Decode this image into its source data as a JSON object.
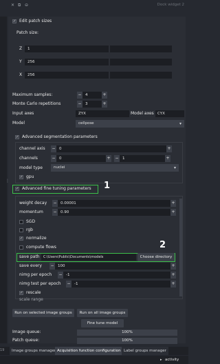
{
  "titlebar": {
    "title": "Dock widget 2"
  },
  "patch": {
    "edit_label": "Edit patch sizes",
    "size_label": "Patch size:",
    "z_label": "Z",
    "z_value": "1",
    "y_label": "Y",
    "y_value": "256",
    "x_label": "X",
    "x_value": "256"
  },
  "sampling": {
    "max_label": "Maximum samples:",
    "max_value": "4",
    "mc_label": "Monte Carlo repetitions",
    "mc_value": "3"
  },
  "axes": {
    "input_label": "Input axes",
    "input_value": "ZYX",
    "model_label": "Model axes",
    "model_value": "CYX"
  },
  "model": {
    "label": "Model",
    "value": "cellpose"
  },
  "seg": {
    "adv_label": "Advanced segmentation parameters",
    "channel_axis_label": "channel axis",
    "channel_axis_value": "0",
    "channels_label": "channels",
    "channels_0": "0",
    "channels_1": "1",
    "model_type_label": "model type",
    "model_type_value": "nuclei",
    "gpu_label": "gpu"
  },
  "ft": {
    "adv_label": "Advanced fine tuning parameters",
    "weight_decay_label": "weight decay",
    "weight_decay_value": "0.00001",
    "momentum_label": "momentum",
    "momentum_value": "0.90",
    "sgd_label": "SGD",
    "rgb_label": "rgb",
    "normalize_label": "normalize",
    "compute_flows_label": "compute flows",
    "save_path_label": "save path",
    "save_path_value": "C:\\Users\\Public\\Documents\\models",
    "choose_dir_label": "Choose directory",
    "save_every_label": "save every",
    "save_every_value": "100",
    "nimg_epoch_label": "nimg per epoch",
    "nimg_epoch_value": "-1",
    "nimg_test_label": "nimg test per epoch",
    "nimg_test_value": "-1",
    "rescale_label": "rescale",
    "scale_range_label": "scale range"
  },
  "callouts": {
    "one": "1",
    "two": "2"
  },
  "actions": {
    "run_selected": "Run on selected image groups",
    "run_all": "Run on all image groups",
    "fine_tune": "Fine tune model"
  },
  "queues": {
    "image_label": "Image queue:",
    "image_value": "100%",
    "image_progress": 1.0,
    "patch_label": "Patch queue:",
    "patch_value": "100%",
    "patch_progress": 1.0
  },
  "tabs": {
    "t1": "Image groups manager",
    "t2": "Acquisition function configuration",
    "t3": "Label groups manager"
  },
  "status": {
    "activity": "activity",
    "left": "19"
  },
  "colors": {
    "highlight": "#3cc04a",
    "panel": "#2b2e35",
    "background": "#262930",
    "field": "#1c1e23"
  }
}
